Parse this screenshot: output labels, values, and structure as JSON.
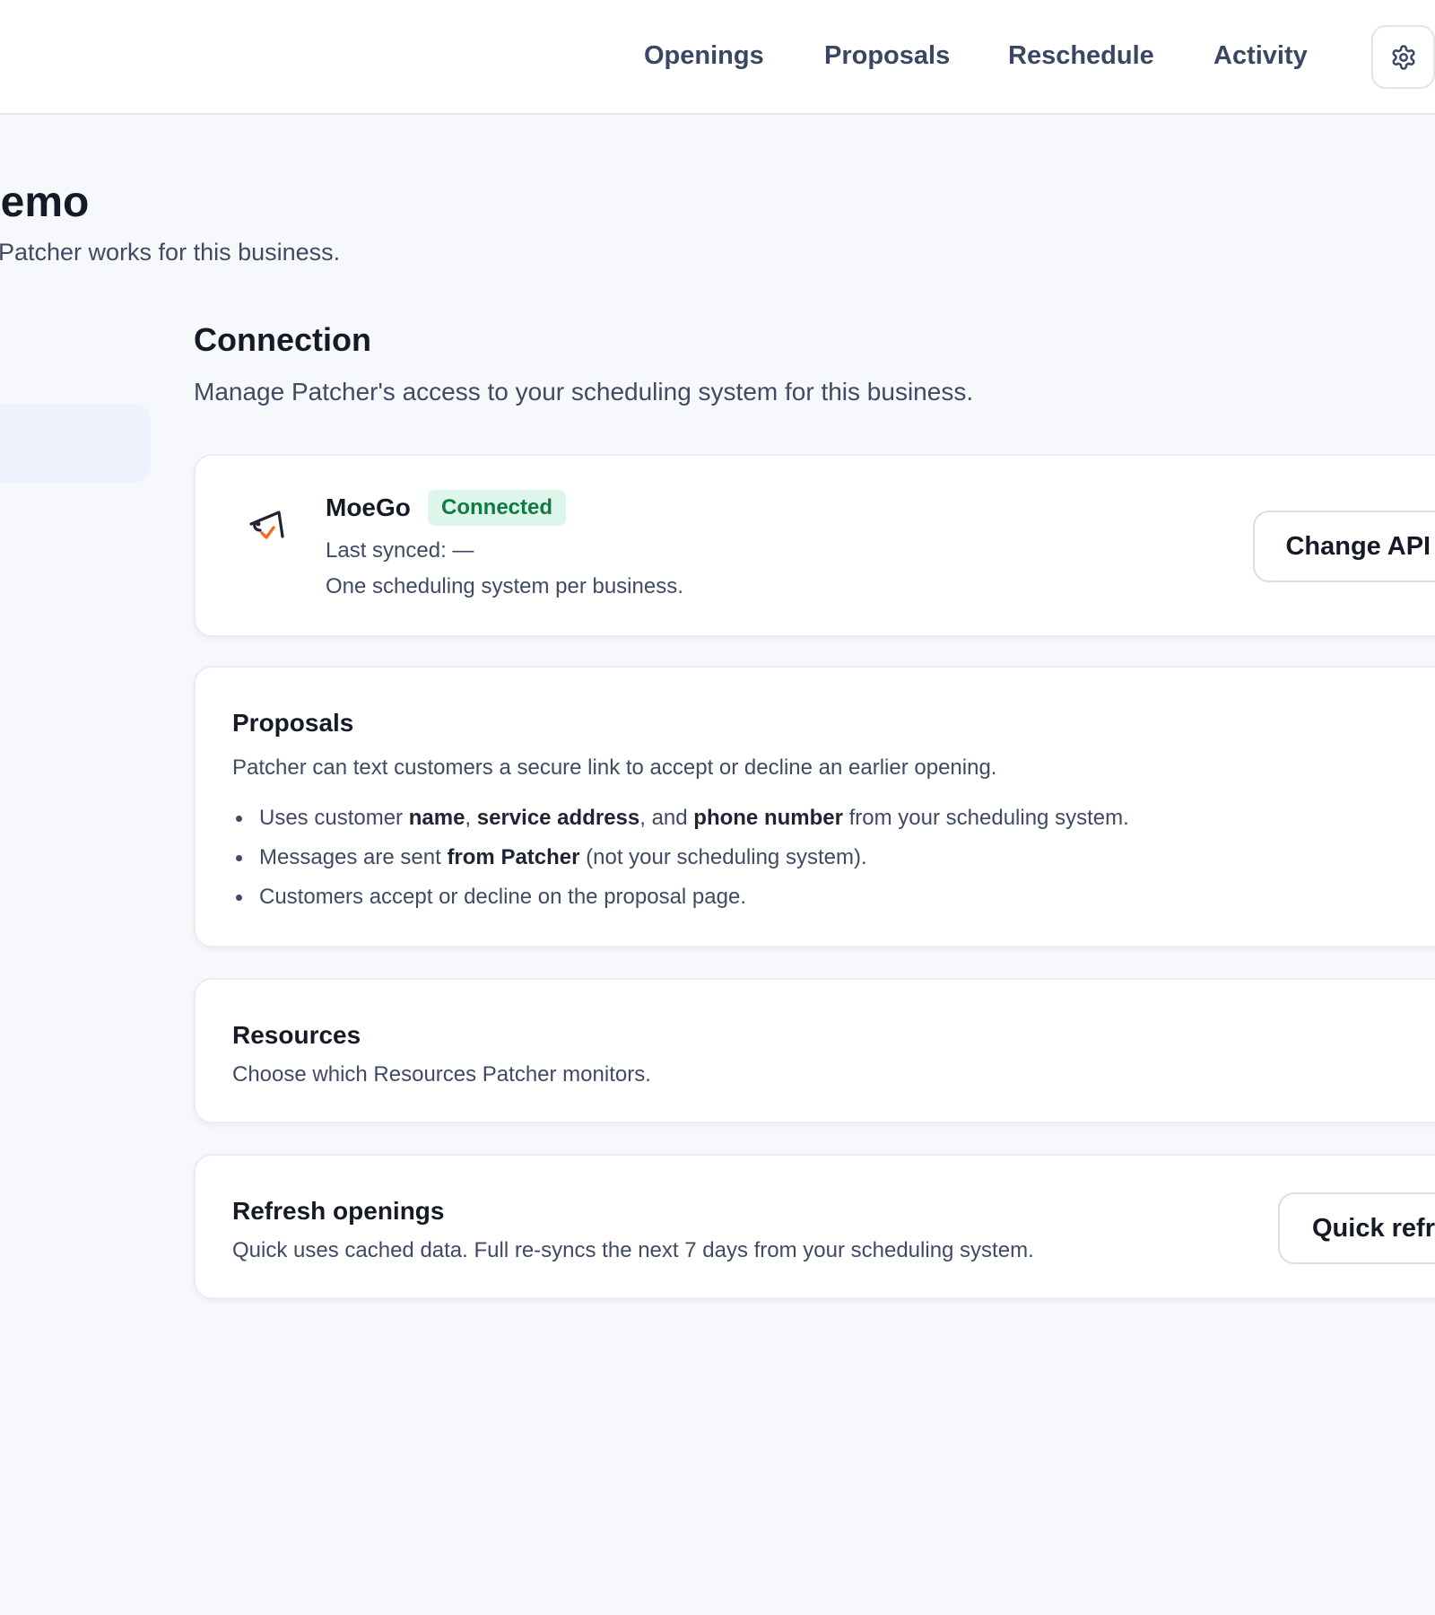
{
  "nav": {
    "items": [
      {
        "label": "Openings"
      },
      {
        "label": "Proposals"
      },
      {
        "label": "Reschedule"
      },
      {
        "label": "Activity"
      }
    ],
    "settings_icon": "gear-icon"
  },
  "page": {
    "title": "Demo",
    "subtitle": "Patcher works for this business."
  },
  "section": {
    "title": "Connection",
    "subtitle": "Manage Patcher's access to your scheduling system for this business."
  },
  "connection_card": {
    "logo_icon": "moego-logo-icon",
    "app_name": "MoeGo",
    "status": "Connected",
    "last_synced": "Last synced: —",
    "note": "One scheduling system per business.",
    "button": "Change API key",
    "colors": {
      "badge_bg": "#ddf5ea",
      "badge_text": "#107a45",
      "logo_accent": "#f26b1d"
    }
  },
  "proposals_card": {
    "title": "Proposals",
    "description": "Patcher can text customers a secure link to accept or decline an earlier opening.",
    "bullets": [
      {
        "parts": [
          {
            "text": "Uses customer ",
            "bold": false
          },
          {
            "text": "name",
            "bold": true
          },
          {
            "text": ", ",
            "bold": false
          },
          {
            "text": "service address",
            "bold": true
          },
          {
            "text": ", and ",
            "bold": false
          },
          {
            "text": "phone number",
            "bold": true
          },
          {
            "text": " from your scheduling system.",
            "bold": false
          }
        ]
      },
      {
        "parts": [
          {
            "text": "Messages are sent ",
            "bold": false
          },
          {
            "text": "from Patcher",
            "bold": true
          },
          {
            "text": " (not your scheduling system).",
            "bold": false
          }
        ]
      },
      {
        "parts": [
          {
            "text": "Customers accept or decline on the proposal page.",
            "bold": false
          }
        ]
      }
    ]
  },
  "resources_card": {
    "title": "Resources",
    "description": "Choose which Resources Patcher monitors."
  },
  "refresh_card": {
    "title": "Refresh openings",
    "description": "Quick uses cached data. Full re-syncs the next 7 days from your scheduling system.",
    "button": "Quick refresh"
  }
}
